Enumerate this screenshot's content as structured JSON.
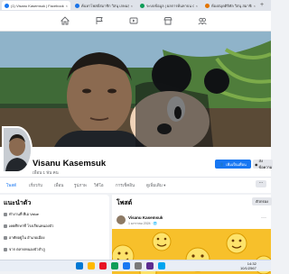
{
  "browser": {
    "tabs": [
      {
        "label": "(1) Visanu Kasemsuk | Facebook",
        "favicon_color": "#1877f2"
      },
      {
        "label": "ค้นหาโพสต์สมาชิก วิสนุ เกษมสุข",
        "favicon_color": "#1a73e8"
      },
      {
        "label": "ระบบข้อมูล | ผลการค้นหาบน Goo",
        "favicon_color": "#0f9d58"
      },
      {
        "label": "ห้องสมุดดิจิทัล วิสนุ สมาชิกเกษม",
        "favicon_color": "#e37400"
      }
    ],
    "new_tab_label": "+",
    "close_symbol": "×"
  },
  "topnav": {
    "icons": [
      "home-icon",
      "flag-icon",
      "video-icon",
      "marketplace-icon",
      "groups-icon"
    ]
  },
  "profile": {
    "name": "Visanu Kasemsuk",
    "friends": "เพื่อน 1 พัน คน",
    "add_friend_label": "เพิ่มเป็นเพื่อน",
    "message_label": "ส่งข้อความ",
    "tabs": [
      "โพสต์",
      "เกี่ยวกับ",
      "เพื่อน",
      "รูปภาพ",
      "วิดีโอ",
      "การเช็คอิน",
      "ดูเพิ่มเติม ▾"
    ],
    "more_dots": "···"
  },
  "intro": {
    "title": "แนะนำตัว",
    "rows": [
      "ทำงานที่ ทีเอ Value",
      "เคยศึกษาที่ โรงเรียนหนองบัว",
      "อาศัยอยู่ใน อำเภอเมือง",
      "จาก ตลาดหนองบัวลำภู"
    ]
  },
  "posts": {
    "title": "โพสต์",
    "filter_label": "ตัวกรอง",
    "author": "Visanu Kasemsuk",
    "meta": "1 มกราคม 2024 · 🌐",
    "menu_dots": "···"
  },
  "taskbar": {
    "time": "14:32",
    "date": "10/1/2567",
    "icon_colors": [
      "#0078d4",
      "#ffb900",
      "#e81123",
      "#0f9d58",
      "#1877f2",
      "#7a7a7a",
      "#5c2d91",
      "#00a4ef"
    ]
  }
}
